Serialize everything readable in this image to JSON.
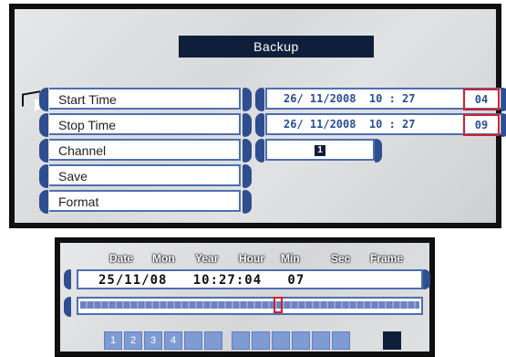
{
  "title": "Backup",
  "menu": [
    {
      "label": "Start Time",
      "value": "26/ 11/2008  10 : 27",
      "highlight": "04"
    },
    {
      "label": "Stop Time",
      "value": "26/ 11/2008  10 : 27",
      "highlight": "09"
    },
    {
      "label": "Channel",
      "channel": "1"
    },
    {
      "label": "Save"
    },
    {
      "label": "Format"
    }
  ],
  "playback": {
    "headers": [
      "Date",
      "Mon",
      "Year",
      "Hour",
      "Min",
      "Sec",
      "Frame"
    ],
    "time_display": "25/11/08   10:27:04   07",
    "controls": [
      "1",
      "2",
      "3",
      "4",
      "",
      "",
      "",
      "",
      "",
      "",
      "",
      "",
      ""
    ]
  },
  "colors": {
    "accent": "#2f4e8f",
    "title_bg": "#0f1f3b",
    "highlight": "#d51f2a"
  }
}
